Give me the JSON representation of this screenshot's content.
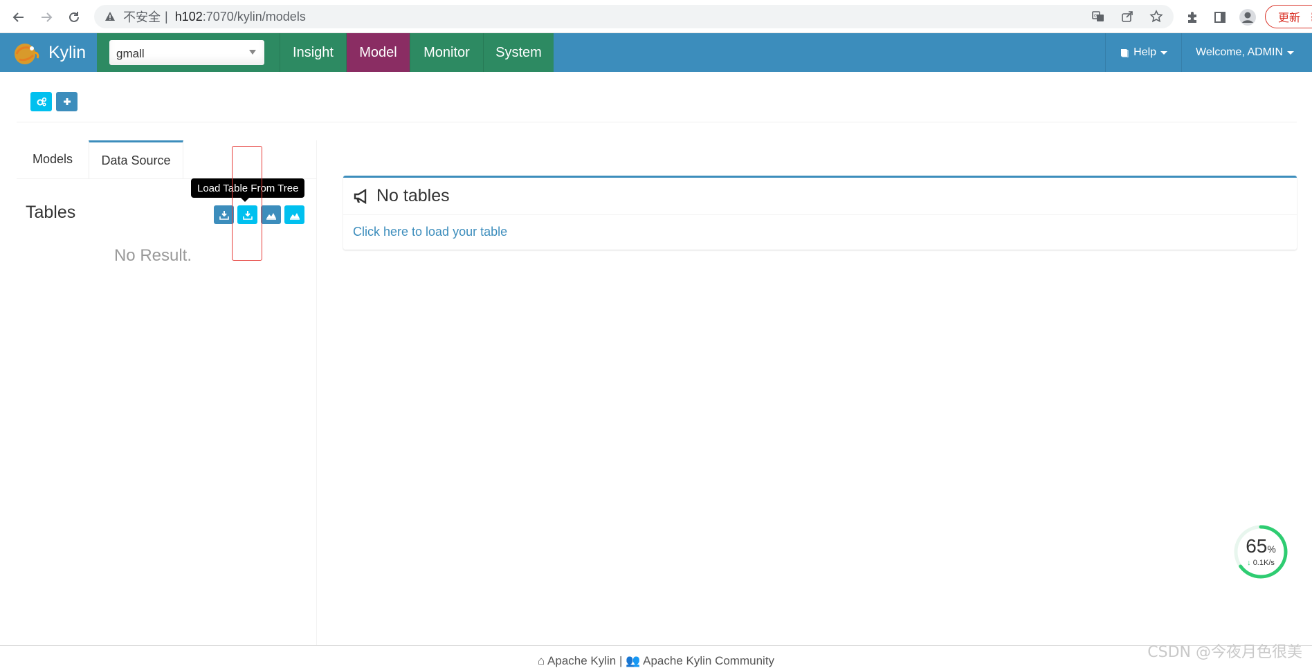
{
  "browser": {
    "insecure_label": "不安全",
    "separator": "|",
    "url_host": "h102",
    "url_rest": ":7070/kylin/models",
    "update_label": "更新"
  },
  "navbar": {
    "brand": "Kylin",
    "project": "gmall",
    "tabs": [
      {
        "label": "Insight"
      },
      {
        "label": "Model"
      },
      {
        "label": "Monitor"
      },
      {
        "label": "System"
      }
    ],
    "help_label": "Help",
    "welcome_label": "Welcome, ADMIN"
  },
  "left_panel": {
    "tabs": [
      {
        "label": "Models"
      },
      {
        "label": "Data Source"
      }
    ],
    "tables_title": "Tables",
    "tooltip": "Load Table From Tree",
    "no_result": "No Result."
  },
  "main_box": {
    "title": "No tables",
    "link": "Click here to load your table"
  },
  "footer": {
    "link1": "Apache Kylin",
    "separator": "|",
    "link2": "Apache Kylin Community"
  },
  "speed_widget": {
    "percent": "65",
    "percent_sign": "%",
    "rate": "0.1K/s",
    "percent_value": 65
  },
  "watermark": "CSDN @今夜月色很美",
  "colors": {
    "kylin_blue": "#3c8dbc",
    "kylin_green": "#2d8a62",
    "model_purple": "#8a2d63",
    "cyan_button": "#00c0ef",
    "highlight_red": "#e53935"
  }
}
